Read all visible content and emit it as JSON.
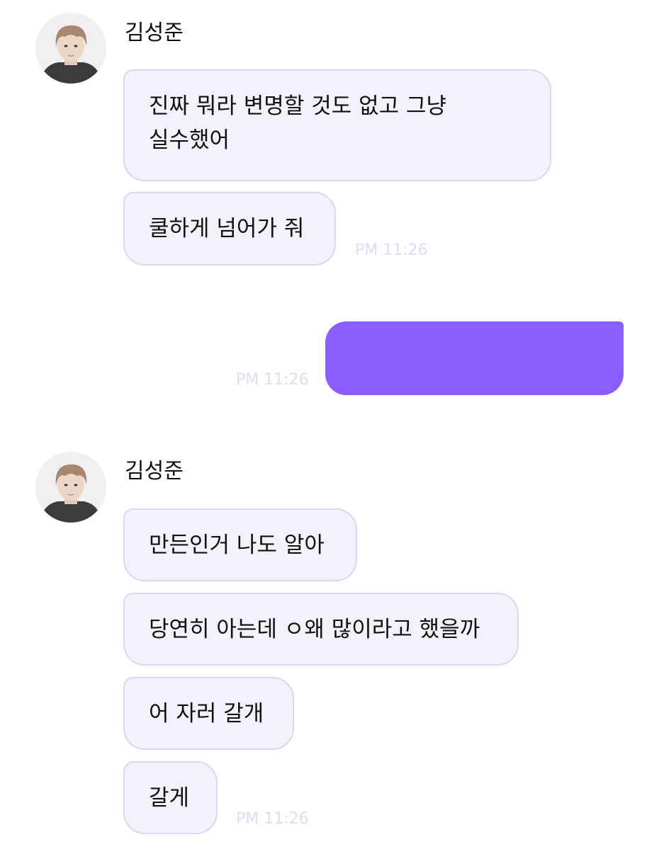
{
  "groups": [
    {
      "sender": "김성준",
      "messages": [
        "진짜 뭐라 변명할 것도 없고 그냥 실수했어",
        "쿨하게 넘어가 줘"
      ],
      "time": "PM 11:26"
    },
    {
      "sender": "me",
      "messages": [
        ""
      ],
      "time": "PM 11:26"
    },
    {
      "sender": "김성준",
      "messages": [
        "만든인거 나도 알아",
        "당연히 아는데 ㅇ왜 많이라고 했을까",
        "어 자러 갈개",
        "갈게"
      ],
      "time": "PM 11:26"
    }
  ],
  "colors": {
    "received_bubble_bg": "#f3f1f9",
    "received_bubble_border": "#e0d4f6",
    "sent_bubble_bg": "#8b5cff",
    "timestamp": "#e3d8f7"
  },
  "icons": {
    "avatar": "profile-photo-icon"
  }
}
